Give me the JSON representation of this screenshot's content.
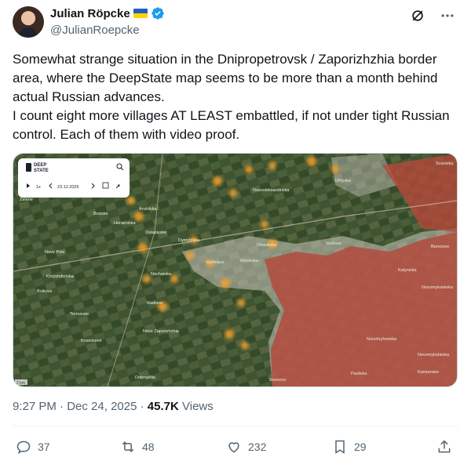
{
  "author": {
    "name": "Julian Röpcke",
    "handle": "@JulianRoepcke"
  },
  "tweet": {
    "text": "Somewhat strange situation in the Dnipropetrovsk / Zaporizhzhia border area, where the DeepState map seems to be more than a month behind actual Russian advances.\nI count eight more villages AT LEAST embattled, if not under tight Russian control. Each of them with video proof.",
    "time": "9:27 PM",
    "date": "Dec 24, 2025",
    "views_count": "45.7K",
    "views_label": "Views"
  },
  "map": {
    "app_name_1": "DEEP",
    "app_name_2": "STATE",
    "date": "23.12.2025",
    "speed": "1x",
    "scale": "2 km",
    "labels": [
      "Zelene",
      "Bratske",
      "Andriivka",
      "Heraimivka",
      "Ostapivske",
      "Dymytrivka",
      "Nove Pole",
      "Khrystoforivka",
      "Nechaivka",
      "Boikove",
      "Radisne",
      "Ternuvate",
      "Nove Zaporizhzhia",
      "Kosivtseve",
      "Dobropillia",
      "Novooleksandrivka",
      "Oleksiivka",
      "Vyshneve",
      "Yehorivka",
      "Verbove",
      "Sosnivka",
      "Olhyvka",
      "Kalynivka",
      "Berezove",
      "Novomykolaivka",
      "Novohryhorivka",
      "Pavlivka",
      "Sosnovo",
      "Novomykolaivka",
      "Kamianske"
    ],
    "colors": {
      "occupied": "#b5483a",
      "contested": "#c9c3bd",
      "advance": "#f3a12a",
      "land": "#3d5131"
    }
  },
  "actions": {
    "replies": "37",
    "reposts": "48",
    "likes": "232",
    "bookmarks": "29"
  }
}
